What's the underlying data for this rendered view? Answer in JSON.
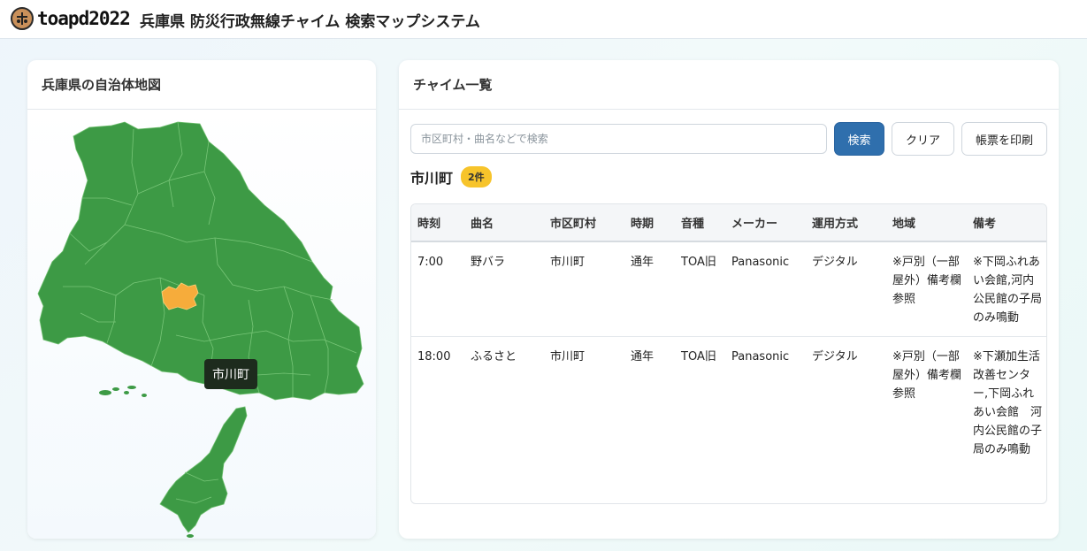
{
  "header": {
    "logo_text": "toapd2022",
    "title": "兵庫県 防災行政無線チャイム 検索マップシステム"
  },
  "map_panel": {
    "title": "兵庫県の自治体地図",
    "tooltip": "市川町",
    "colors": {
      "land": "#3d9a45",
      "selected": "#f6ac3b",
      "border": "#6fbf6f"
    }
  },
  "list_panel": {
    "title": "チャイム一覧",
    "search": {
      "placeholder": "市区町村・曲名などで検索",
      "value": ""
    },
    "buttons": {
      "search": "検索",
      "clear": "クリア",
      "print": "帳票を印刷"
    },
    "result_title": "市川町",
    "result_count": "2件",
    "columns": [
      "時刻",
      "曲名",
      "市区町村",
      "時期",
      "音種",
      "メーカー",
      "運用方式",
      "地域",
      "備考"
    ],
    "rows": [
      [
        "7:00",
        "野バラ",
        "市川町",
        "通年",
        "TOA旧",
        "Panasonic",
        "デジタル",
        "※戸別（一部屋外）備考欄参照",
        "※下岡ふれあい会館,河内公民館の子局のみ鳴動"
      ],
      [
        "18:00",
        "ふるさと",
        "市川町",
        "通年",
        "TOA旧",
        "Panasonic",
        "デジタル",
        "※戸別（一部屋外）備考欄参照",
        "※下瀬加生活改善センター,下岡ふれあい会館　河内公民館の子局のみ鳴動"
      ]
    ]
  }
}
